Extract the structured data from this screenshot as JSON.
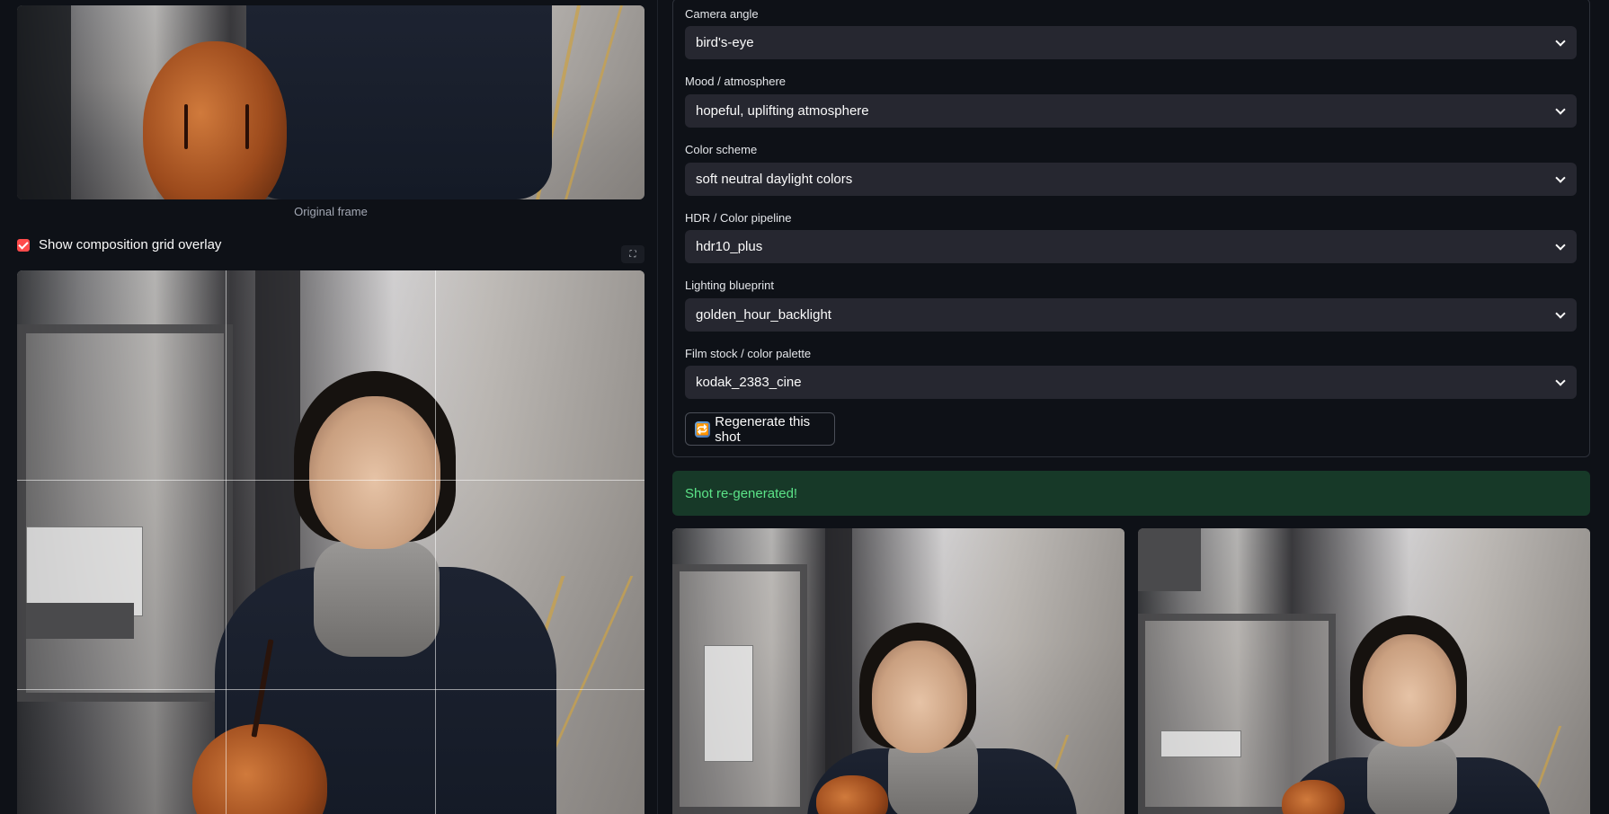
{
  "original_frame": {
    "caption": "Original frame"
  },
  "grid_toggle": {
    "label": "Show composition grid overlay",
    "checked": true
  },
  "fields": [
    {
      "label": "Camera angle",
      "value": "bird's-eye"
    },
    {
      "label": "Mood / atmosphere",
      "value": "hopeful, uplifting atmosphere"
    },
    {
      "label": "Color scheme",
      "value": "soft neutral daylight colors"
    },
    {
      "label": "HDR / Color pipeline",
      "value": "hdr10_plus"
    },
    {
      "label": "Lighting blueprint",
      "value": "golden_hour_backlight"
    },
    {
      "label": "Film stock / color palette",
      "value": "kodak_2383_cine"
    }
  ],
  "regenerate": {
    "label": "Regenerate this shot",
    "icon": "repeat-icon"
  },
  "status": {
    "message": "Shot re-generated!",
    "color": "#5ce488",
    "background": "#173928"
  },
  "colors": {
    "accent": "#ff4b4b",
    "background": "#0e1117",
    "input": "#262730"
  }
}
